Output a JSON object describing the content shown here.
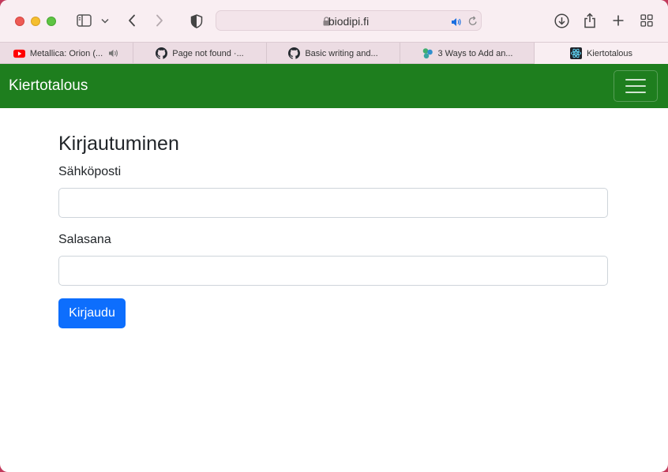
{
  "browser": {
    "url": "biodipi.fi",
    "tabs": [
      {
        "title": "Metallica: Orion (...",
        "favicon": "youtube-icon",
        "audio": true
      },
      {
        "title": "Page not found ·...",
        "favicon": "github-icon"
      },
      {
        "title": "Basic writing and...",
        "favicon": "github-icon"
      },
      {
        "title": "3 Ways to Add an...",
        "favicon": "site-icon"
      },
      {
        "title": "Kiertotalous",
        "favicon": "react-icon",
        "active": true
      }
    ]
  },
  "navbar": {
    "brand": "Kiertotalous",
    "background": "#1e7e1e"
  },
  "login": {
    "title": "Kirjautuminen",
    "email_label": "Sähköposti",
    "email_value": "",
    "password_label": "Salasana",
    "password_value": "",
    "submit_label": "Kirjaudu",
    "button_color": "#0d6efd"
  }
}
